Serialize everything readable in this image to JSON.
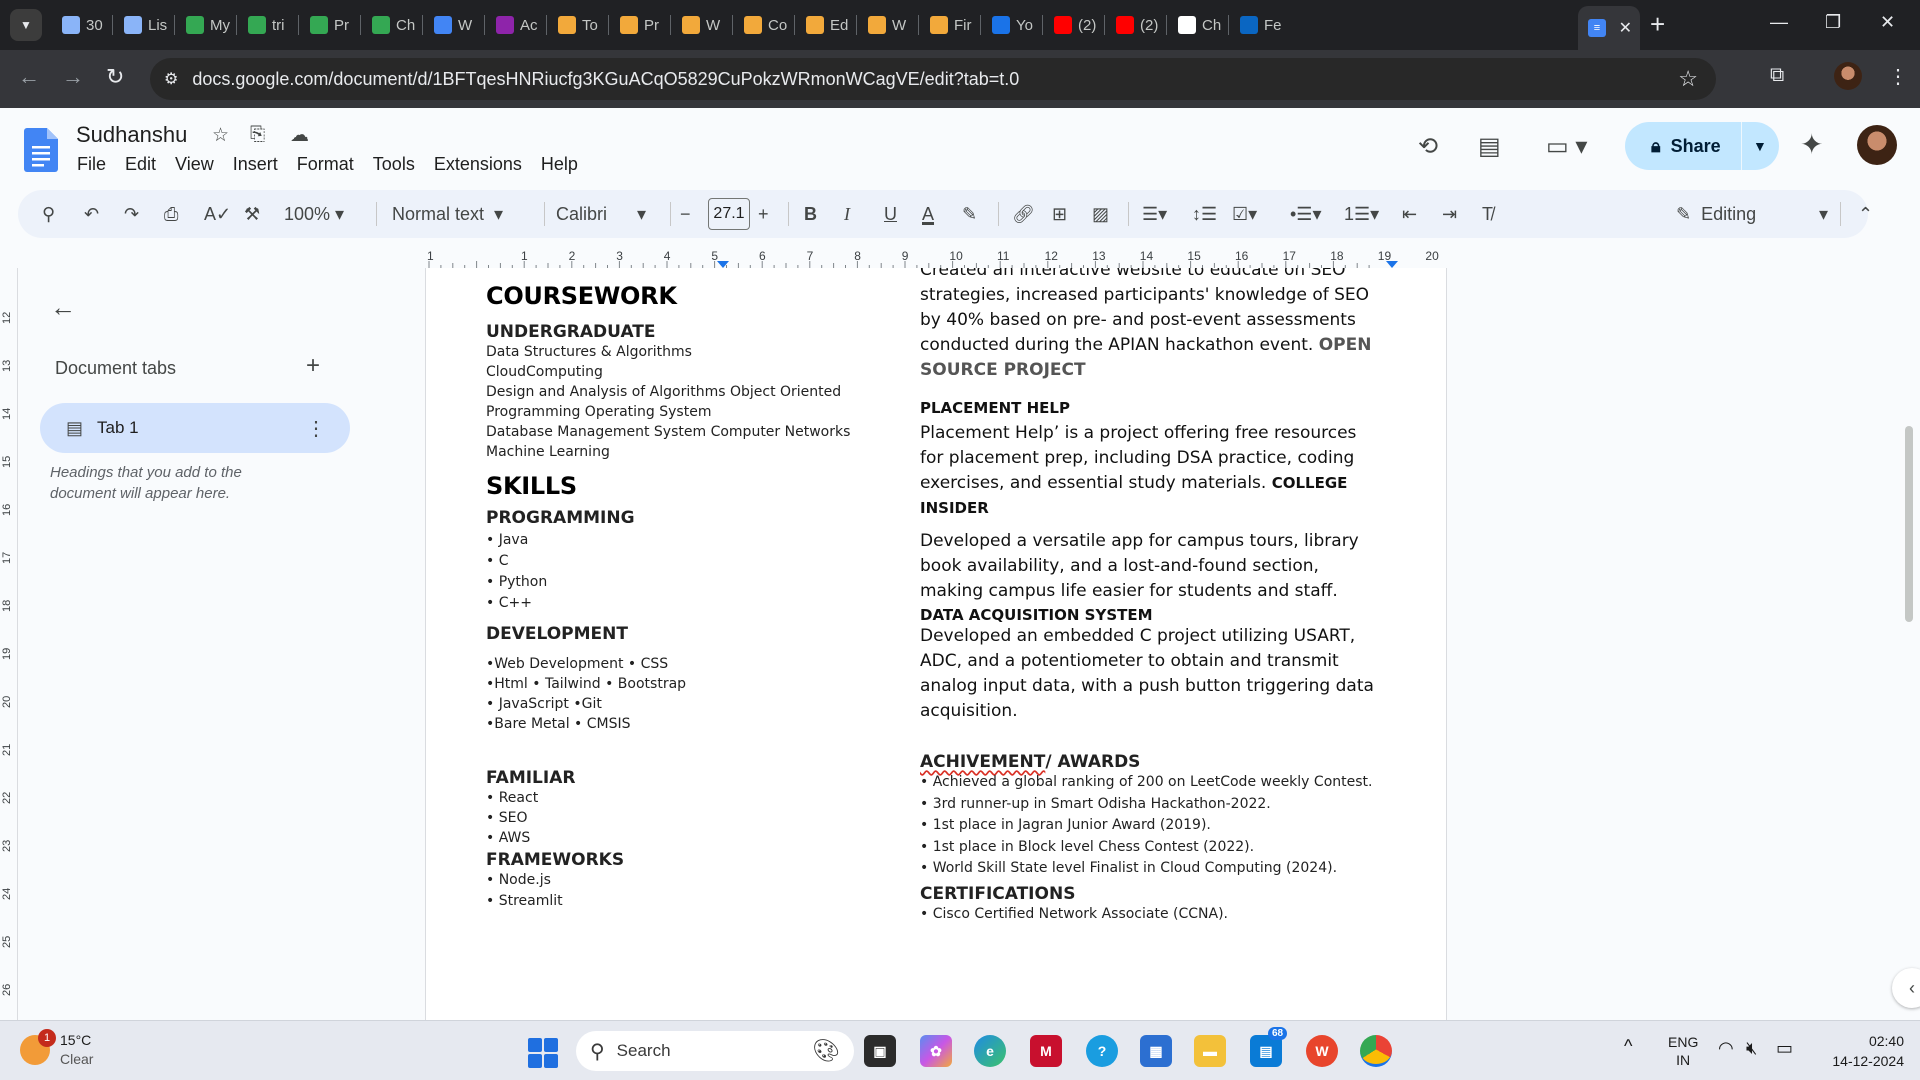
{
  "browser": {
    "tabs": [
      {
        "label": "30",
        "color": "#8ab4f8",
        "icon": "mountain-icon"
      },
      {
        "label": "Lis",
        "color": "#8ab4f8",
        "icon": "mountain-icon"
      },
      {
        "label": "My",
        "color": "#34a853",
        "icon": "drive-icon"
      },
      {
        "label": "tri",
        "color": "#34a853",
        "icon": "infinity-icon"
      },
      {
        "label": "Pr",
        "color": "#34a853",
        "icon": "infinity-icon"
      },
      {
        "label": "Ch",
        "color": "#34a853",
        "icon": "infinity-icon"
      },
      {
        "label": "W",
        "color": "#4285f4",
        "icon": "headphones-icon"
      },
      {
        "label": "Ac",
        "color": "#8e24aa",
        "icon": "visual-studio-icon"
      },
      {
        "label": "To",
        "color": "#f2a93b",
        "icon": "bolt-icon"
      },
      {
        "label": "Pr",
        "color": "#f2a93b",
        "icon": "bolt-icon"
      },
      {
        "label": "W",
        "color": "#f2a93b",
        "icon": "bolt-icon"
      },
      {
        "label": "Co",
        "color": "#f2a93b",
        "icon": "bolt-icon"
      },
      {
        "label": "Ed",
        "color": "#f2a93b",
        "icon": "bolt-icon"
      },
      {
        "label": "W",
        "color": "#f2a93b",
        "icon": "bolt-icon"
      },
      {
        "label": "Fir",
        "color": "#f2a93b",
        "icon": "bolt-icon"
      },
      {
        "label": "Yo",
        "color": "#1a73e8",
        "icon": "video-icon"
      },
      {
        "label": "(2)",
        "color": "#ff0000",
        "icon": "youtube-icon"
      },
      {
        "label": "(2)",
        "color": "#ff0000",
        "icon": "youtube-icon"
      },
      {
        "label": "Ch",
        "color": "#ffffff",
        "icon": "chatgpt-icon"
      },
      {
        "label": "Fe",
        "color": "#0a66c2",
        "icon": "linkedin-icon"
      }
    ],
    "url": "docs.google.com/document/d/1BFTqesHNRiucfg3KGuACqO5829CuPokzWRmonWCagVE/edit?tab=t.0"
  },
  "docs": {
    "title": "Sudhanshu",
    "menu": [
      "File",
      "Edit",
      "View",
      "Insert",
      "Format",
      "Tools",
      "Extensions",
      "Help"
    ],
    "share_label": "Share",
    "toolbar": {
      "zoom": "100%",
      "style": "Normal text",
      "font": "Calibri",
      "font_size": "27.1",
      "mode": "Editing"
    }
  },
  "sidebar": {
    "title": "Document tabs",
    "tab_label": "Tab 1",
    "hint": "Headings that you add to the document will appear here."
  },
  "ruler": {
    "h_marks": [
      "1",
      "1",
      "2",
      "3",
      "4",
      "5",
      "6",
      "7",
      "8",
      "9",
      "10",
      "11",
      "12",
      "13",
      "14",
      "15",
      "16",
      "17",
      "18",
      "19",
      "20"
    ],
    "v_marks": [
      "12",
      "13",
      "14",
      "15",
      "16",
      "17",
      "18",
      "19",
      "20",
      "21",
      "22",
      "23",
      "24",
      "25",
      "26"
    ]
  },
  "resume": {
    "coursework": {
      "heading": "COURSEWORK",
      "sub": "UNDERGRADUATE",
      "lines": [
        "Data Structures & Algorithms",
        "CloudComputing",
        "Design and Analysis of Algorithms Object Oriented",
        "Programming Operating System",
        "Database Management System Computer Networks",
        "Machine Learning"
      ]
    },
    "skills": {
      "heading": "SKILLS",
      "programming_title": "PROGRAMMING",
      "programming": [
        "• Java",
        "• C",
        "• Python",
        "• C++"
      ],
      "development_title": "DEVELOPMENT",
      "development": [
        "•Web Development • CSS",
        "•Html • Tailwind • Bootstrap",
        "• JavaScript •Git",
        "•Bare Metal • CMSIS"
      ],
      "familiar_title": "FAMILIAR",
      "familiar": [
        "• React",
        "• SEO",
        "• AWS"
      ],
      "frameworks_title": "FRAMEWORKS",
      "frameworks": [
        "• Node.js",
        "• Streamlit"
      ]
    },
    "projects": {
      "seo_text": "Created an interactive website to educate on SEO strategies, increased  participants' knowledge of SEO by 40% based on pre- and post-event  assessments conducted during the APIAN hackathon event.",
      "open_source": "OPEN SOURCE PROJECT",
      "placement_title": "PLACEMENT HELP",
      "placement_text": "Placement Help’ is a project offering free resources for placement prep,  including DSA practice, coding exercises, and essential study materials.",
      "college_title": "COLLEGE INSIDER",
      "college_text": "Developed a versatile app for campus tours, library book availability, and  a lost-and-found section, making campus life easier for students and staff.",
      "daq_title": "DATA ACQUISITION SYSTEM",
      "daq_text": "Developed an embedded C project utilizing USART, ADC, and a  potentiometer to obtain and transmit analog input data, with a push  button triggering data acquisition."
    },
    "achievements": {
      "heading_a": "ACHIVEMENT",
      "heading_b": "/ AWARDS",
      "items": [
        "• Achieved a global ranking of 200 on LeetCode weekly Contest.",
        "• 3rd runner-up in Smart Odisha Hackathon-2022.",
        "• 1st place in Jagran Junior Award (2019).",
        "• 1st place in Block level Chess Contest (2022).",
        "• World Skill State level Finalist in Cloud Computing (2024)."
      ]
    },
    "certifications": {
      "heading": "CERTIFICATIONS",
      "items": [
        "• Cisco Certified Network Associate (CCNA)."
      ]
    }
  },
  "taskbar": {
    "weather_temp": "15°C",
    "weather_desc": "Clear",
    "weather_badge": "1",
    "search_placeholder": "Search",
    "store_badge": "68",
    "lang_1": "ENG",
    "lang_2": "IN",
    "time": "02:40",
    "date": "14-12-2024"
  }
}
